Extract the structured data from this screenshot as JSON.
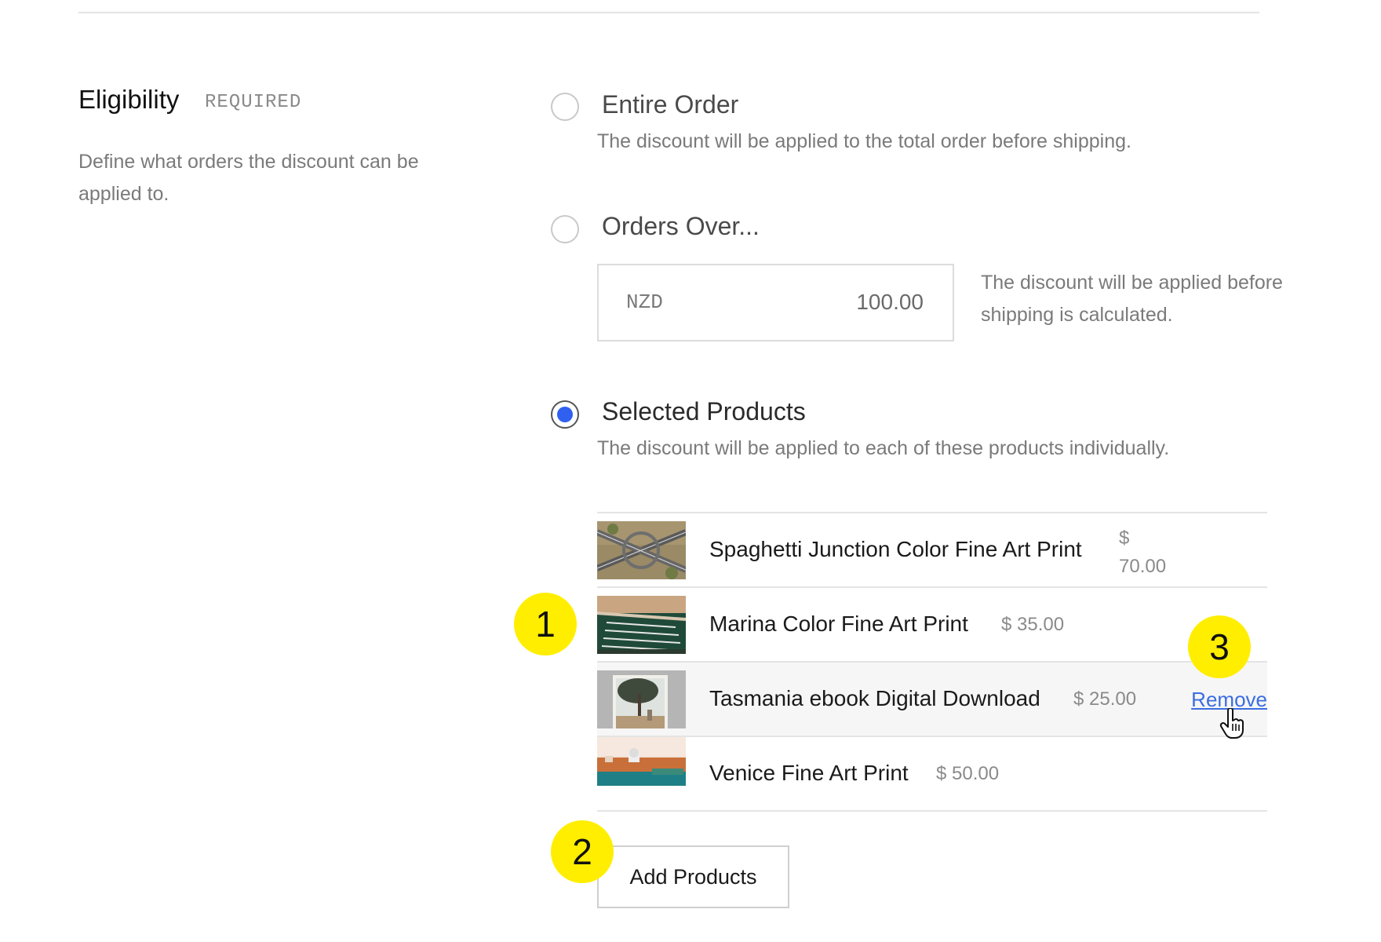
{
  "eligibility": {
    "title": "Eligibility",
    "required_tag": "REQUIRED",
    "description": "Define what orders the discount can be applied to."
  },
  "options": [
    {
      "label": "Entire Order",
      "description": "The discount will be applied to the total order before shipping.",
      "selected": false
    },
    {
      "label": "Orders Over...",
      "selected": false
    },
    {
      "label": "Selected Products",
      "description": "The discount will be applied to each of these products individually.",
      "selected": true
    }
  ],
  "orders_over": {
    "currency": "NZD",
    "amount": "100.00",
    "note": "The discount will be applied before shipping is calculated."
  },
  "products": [
    {
      "name": "Spaghetti Junction Color Fine Art Print",
      "price_symbol": "$",
      "price_value": "70.00",
      "thumb_icon": "aerial-highway-photo"
    },
    {
      "name": "Marina Color Fine Art Print",
      "price": "$ 35.00",
      "thumb_icon": "aerial-marina-photo"
    },
    {
      "name": "Tasmania ebook Digital Download",
      "price": "$ 25.00",
      "thumb_icon": "tree-book-cover"
    },
    {
      "name": "Venice Fine Art Print",
      "price": "$ 50.00",
      "thumb_icon": "venice-waterfront-photo"
    }
  ],
  "remove_label": "Remove",
  "add_products_label": "Add Products",
  "markers": [
    "1",
    "2",
    "3"
  ],
  "colors": {
    "accent": "#2f60f0",
    "link": "#3b6ee0",
    "marker": "#ffee00"
  }
}
